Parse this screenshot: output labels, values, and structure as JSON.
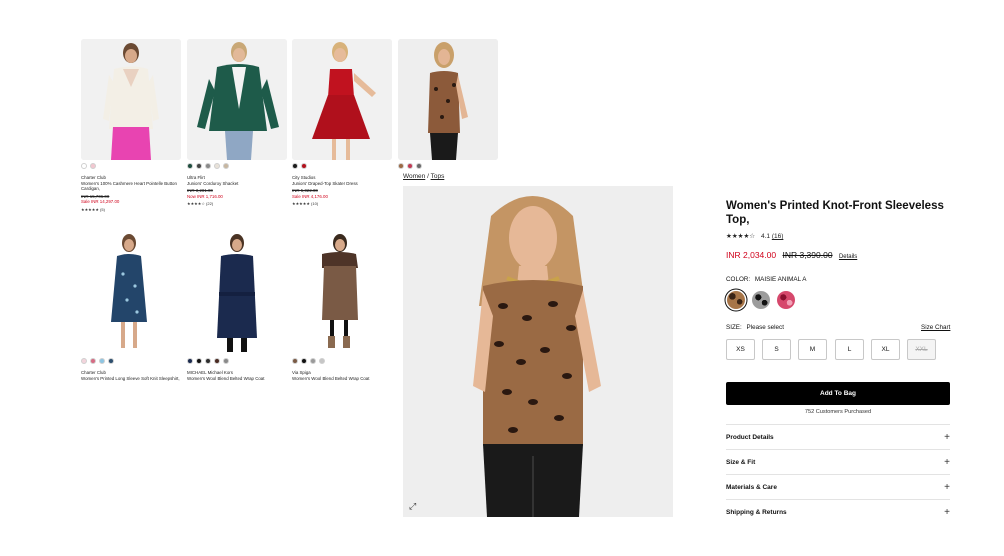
{
  "grid": [
    {
      "brand": "Charter Club",
      "name": "Women's 100% Cashmere Heart Pointelle Button Cardigan,",
      "orig": "INR 15,706.00",
      "sale": "Sale INR 14,297.00",
      "rating": "★★★★★ (5)",
      "swatches": [
        "#ffffff",
        "#f2c8d0"
      ]
    },
    {
      "brand": "Ultra Flirt",
      "name": "Juniors' Corduroy Shacket",
      "orig": "INR 3,281.00",
      "sale": "Now INR 1,716.00",
      "rating": "★★★★☆ (22)",
      "swatches": [
        "#1e4d3e",
        "#444444",
        "#8a8a8a",
        "#e8e2d9",
        "#c7b7a0"
      ]
    },
    {
      "brand": "City Studios",
      "name": "Juniors' Draped-Top Skater Dress",
      "orig": "INR 5,022.00",
      "sale": "Sale INR 4,176.00",
      "rating": "★★★★★ (10)",
      "swatches": [
        "#1c1c1c",
        "#b3121e"
      ]
    },
    {
      "brand": "",
      "name": "",
      "orig": "",
      "sale": "",
      "rating": "",
      "swatches": [
        "#9c6a45",
        "#c23a55",
        "#6a6a6a"
      ]
    },
    {
      "brand": "Charter Club",
      "name": "Women's Printed Long Sleeve Soft Knit Sleepshirt,",
      "orig": "",
      "sale": "",
      "rating": "",
      "swatches": [
        "#f3d4dc",
        "#d66b83",
        "#8ec6e3",
        "#2d4f6e"
      ]
    },
    {
      "brand": "MICHAEL Michael Kors",
      "name": "Women's Wool Blend Belted Wrap Coat",
      "orig": "",
      "sale": "",
      "rating": "",
      "swatches": [
        "#1b2a4e",
        "#111111",
        "#2e2e2e",
        "#4a2a22",
        "#8a8a8a"
      ]
    },
    {
      "brand": "Via Spiga",
      "name": "Women's Wool Blend Belted Wrap Coat",
      "orig": "",
      "sale": "",
      "rating": "",
      "swatches": [
        "#7a5a45",
        "#111111",
        "#9a9a9a",
        "#c6c6c6"
      ]
    }
  ],
  "breadcrumb": {
    "women": "Women",
    "sep": " / ",
    "tops": "Tops"
  },
  "product": {
    "title": "Women's Printed Knot-Front Sleeveless Top,",
    "stars": "★★★★☆",
    "rating": "4.1",
    "review_count": "(16)",
    "price_now": "INR 2,034.00",
    "price_was": "INR 3,390.00",
    "details_link": "Details",
    "color_label": "COLOR:",
    "color_name": "MAISIE ANIMAL A",
    "size_label": "SIZE:",
    "size_prompt": "Please select",
    "size_chart": "Size Chart",
    "sizes": [
      "XS",
      "S",
      "M",
      "L",
      "XL",
      "XXL"
    ],
    "add_to_bag": "Add To Bag",
    "purchased": "752 Customers Purchased",
    "accordions": [
      "Product Details",
      "Size & Fit",
      "Materials & Care",
      "Shipping & Returns"
    ],
    "plus": "+",
    "expand_icon": "⤢"
  },
  "colors": {
    "sale": "#d0021b",
    "button": "#000000"
  }
}
